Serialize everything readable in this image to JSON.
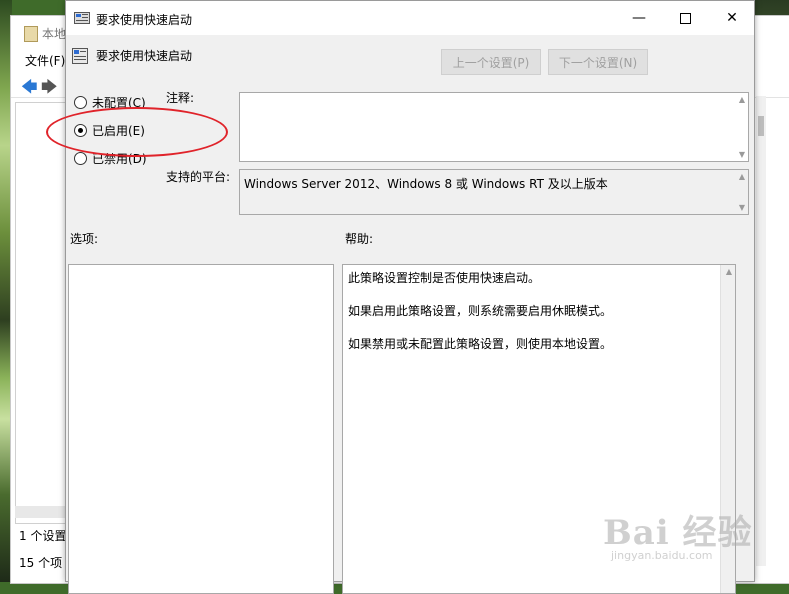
{
  "background_window": {
    "title": "本地",
    "menu_file": "文件(F)",
    "status_1": "1 个设置",
    "status_2": "15 个项"
  },
  "dialog": {
    "title": "要求使用快速启动",
    "header": "要求使用快速启动",
    "buttons": {
      "prev": "上一个设置(P)",
      "next": "下一个设置(N)"
    },
    "radios": [
      {
        "label": "未配置(C)",
        "selected": false
      },
      {
        "label": "已启用(E)",
        "selected": true
      },
      {
        "label": "已禁用(D)",
        "selected": false
      }
    ],
    "comment_label": "注释:",
    "comment_value": "",
    "platform_label": "支持的平台:",
    "platform_value": "Windows Server 2012、Windows 8 或 Windows RT 及以上版本",
    "options_label": "选项:",
    "help_label": "帮助:",
    "help_lines": [
      "此策略设置控制是否使用快速启动。",
      "如果启用此策略设置，则系统需要启用休眠模式。",
      "如果禁用或未配置此策略设置，则使用本地设置。"
    ]
  },
  "annotation": {
    "color": "#e0232a"
  },
  "watermark": {
    "brand": "Bai 经验",
    "url": "jingyan.baidu.com"
  }
}
